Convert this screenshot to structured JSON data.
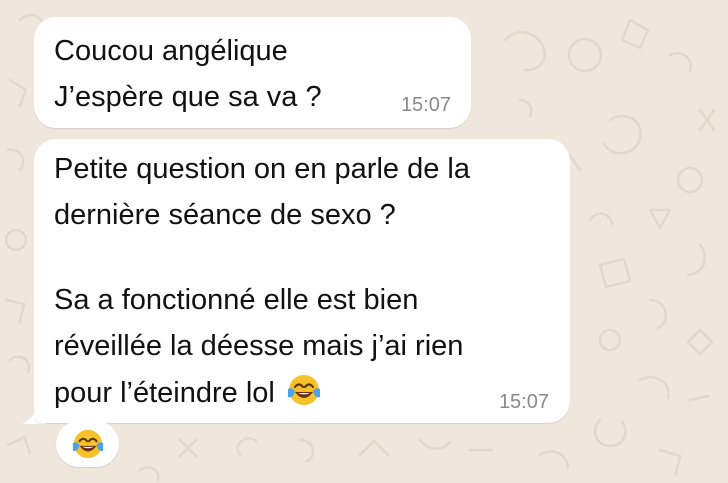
{
  "chat": {
    "messages": [
      {
        "lines": [
          "Coucou angélique",
          "J’espère que sa va ?"
        ],
        "time": "15:07"
      },
      {
        "lines": [
          "Petite question on en parle de la",
          "dernière séance de sexo ?",
          "",
          "Sa a fonctionné elle est bien",
          "réveillée la déesse mais j’ai rien",
          "pour l’éteindre lol"
        ],
        "inline_emoji": "face-with-tears-of-joy-emoji",
        "time": "15:07"
      }
    ],
    "reaction": {
      "emoji": "face-with-tears-of-joy-emoji"
    }
  },
  "colors": {
    "background": "#efe7dc",
    "bubble": "#ffffff",
    "text": "#111111",
    "time": "#8a8a8a",
    "emoji_face": "#f7c12a"
  }
}
